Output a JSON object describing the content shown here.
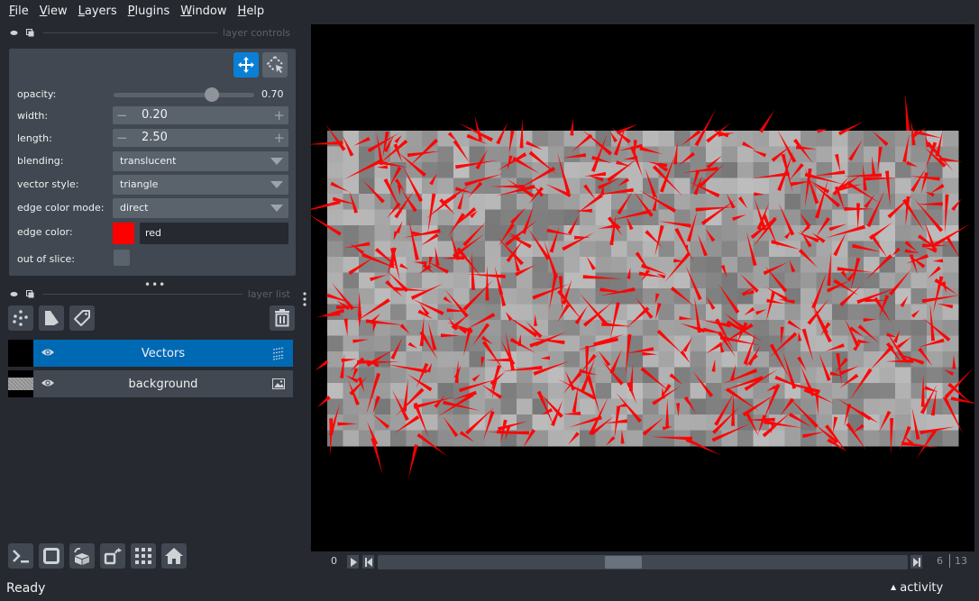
{
  "menu": [
    {
      "label": "File",
      "mnemonic": "F",
      "rest": "ile"
    },
    {
      "label": "View",
      "mnemonic": "V",
      "rest": "iew"
    },
    {
      "label": "Layers",
      "mnemonic": "L",
      "rest": "ayers"
    },
    {
      "label": "Plugins",
      "mnemonic": "P",
      "rest": "lugins"
    },
    {
      "label": "Window",
      "mnemonic": "W",
      "rest": "indow"
    },
    {
      "label": "Help",
      "mnemonic": "H",
      "rest": "elp"
    }
  ],
  "layer_controls": {
    "title": "layer controls",
    "opacity": {
      "label": "opacity:",
      "value": 0.7,
      "display": "0.70"
    },
    "width": {
      "label": "width:",
      "value": "0.20"
    },
    "length": {
      "label": "length:",
      "value": "2.50"
    },
    "blending": {
      "label": "blending:",
      "value": "translucent"
    },
    "vector_style": {
      "label": "vector style:",
      "value": "triangle"
    },
    "edge_color_mode": {
      "label": "edge color mode:",
      "value": "direct"
    },
    "edge_color": {
      "label": "edge color:",
      "value": "red",
      "swatch": "#ff0000"
    },
    "out_of_slice": {
      "label": "out of slice:",
      "checked": false
    },
    "modes": [
      {
        "name": "pan-zoom",
        "icon": "move-arrows-icon",
        "active": true
      },
      {
        "name": "transform",
        "icon": "select-transform-icon",
        "active": false
      }
    ]
  },
  "layer_list": {
    "title": "layer list",
    "layers": [
      {
        "name": "Vectors",
        "visible": true,
        "selected": true,
        "type_icon": "vectors-icon"
      },
      {
        "name": "background",
        "visible": true,
        "selected": false,
        "type_icon": "image-icon"
      }
    ]
  },
  "dims": {
    "axis_index": "0",
    "current": "6",
    "max": "13",
    "slider_fraction": 0.46
  },
  "status": "Ready",
  "activity_label": "activity",
  "colors": {
    "accent": "#0a7fd6",
    "selected_layer": "#0069b4",
    "panel_bg": "#262930",
    "control_bg": "#414851",
    "edge": "#ff0000"
  }
}
